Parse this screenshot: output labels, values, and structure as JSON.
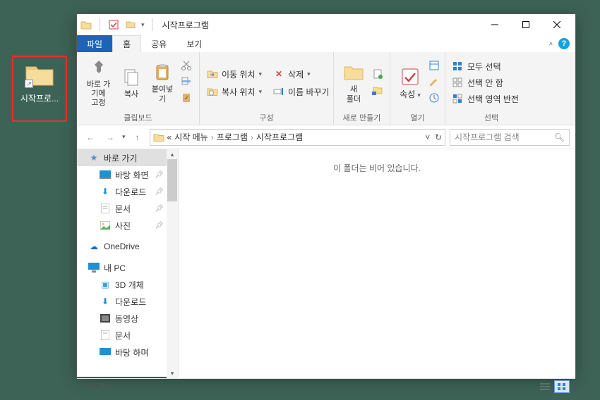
{
  "desktop": {
    "icon_label": "시작프로..."
  },
  "window": {
    "title": "시작프로그램",
    "tabs": {
      "file": "파일",
      "home": "홈",
      "share": "공유",
      "view": "보기"
    },
    "ribbon": {
      "clipboard": {
        "label": "클립보드",
        "pin": "바로 가기에\n고정",
        "copy": "복사",
        "paste": "붙여넣기"
      },
      "organize": {
        "label": "구성",
        "move": "이동 위치",
        "copyto": "복사 위치",
        "delete": "삭제",
        "rename": "이름 바꾸기"
      },
      "new": {
        "label": "새로 만들기",
        "newfolder": "새\n폴더"
      },
      "open": {
        "label": "열기",
        "properties": "속성"
      },
      "select": {
        "label": "선택",
        "all": "모두 선택",
        "none": "선택 안 함",
        "invert": "선택 영역 반전"
      }
    },
    "breadcrumb": {
      "prefix": "«",
      "parts": [
        "시작 메뉴",
        "프로그램",
        "시작프로그램"
      ]
    },
    "search_placeholder": "시작프로그램 검색",
    "nav": {
      "quick": "바로 가기",
      "desktop": "바탕 화면",
      "downloads": "다운로드",
      "documents": "문서",
      "pictures": "사진",
      "onedrive": "OneDrive",
      "pc": "내 PC",
      "3d": "3D 개체",
      "pc_down": "다운로드",
      "videos": "동영상",
      "pc_docs": "문서",
      "pc_desk": "바탕 하며"
    },
    "empty_msg": "이 폴더는 비어 있습니다.",
    "status": "0개 항목"
  }
}
